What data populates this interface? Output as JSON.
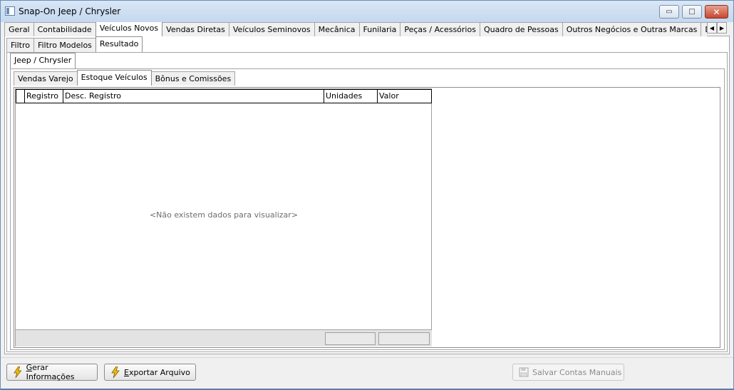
{
  "window": {
    "title": "Snap-On Jeep / Chrysler",
    "min_glyph": "▭",
    "max_glyph": "□",
    "close_glyph": "✕"
  },
  "main_tabs": [
    "Geral",
    "Contabilidade",
    "Veículos Novos",
    "Vendas Diretas",
    "Veículos Seminovos",
    "Mecânica",
    "Funilaria",
    "Peças / Acessórios",
    "Quadro de Pessoas",
    "Outros Negócios e Outras Marcas",
    "Despesas Gerais por Departamento"
  ],
  "main_tab_active": 2,
  "scroll": {
    "left": "◀",
    "right": "▶"
  },
  "sub_tabs": [
    "Filtro",
    "Filtro Modelos",
    "Resultado"
  ],
  "sub_tab_active": 2,
  "brand_tabs": [
    "Jeep / Chrysler"
  ],
  "report_tabs": [
    "Vendas Varejo",
    "Estoque Veículos",
    "Bônus e Comissões"
  ],
  "report_tab_active": 1,
  "grid": {
    "columns": [
      "Registro",
      "Desc. Registro",
      "Unidades",
      "Valor"
    ],
    "empty_message": "<Não existem dados para visualizar>"
  },
  "buttons": {
    "gerar": {
      "label_u": "G",
      "label_rest": "erar Informações"
    },
    "exportar": {
      "label_u": "E",
      "label_rest": "xportar Arquivo"
    },
    "salvar": {
      "label": "Salvar Contas Manuais"
    }
  },
  "colors": {
    "accent": "#6a8fb8",
    "bolt": "#f2c200"
  }
}
